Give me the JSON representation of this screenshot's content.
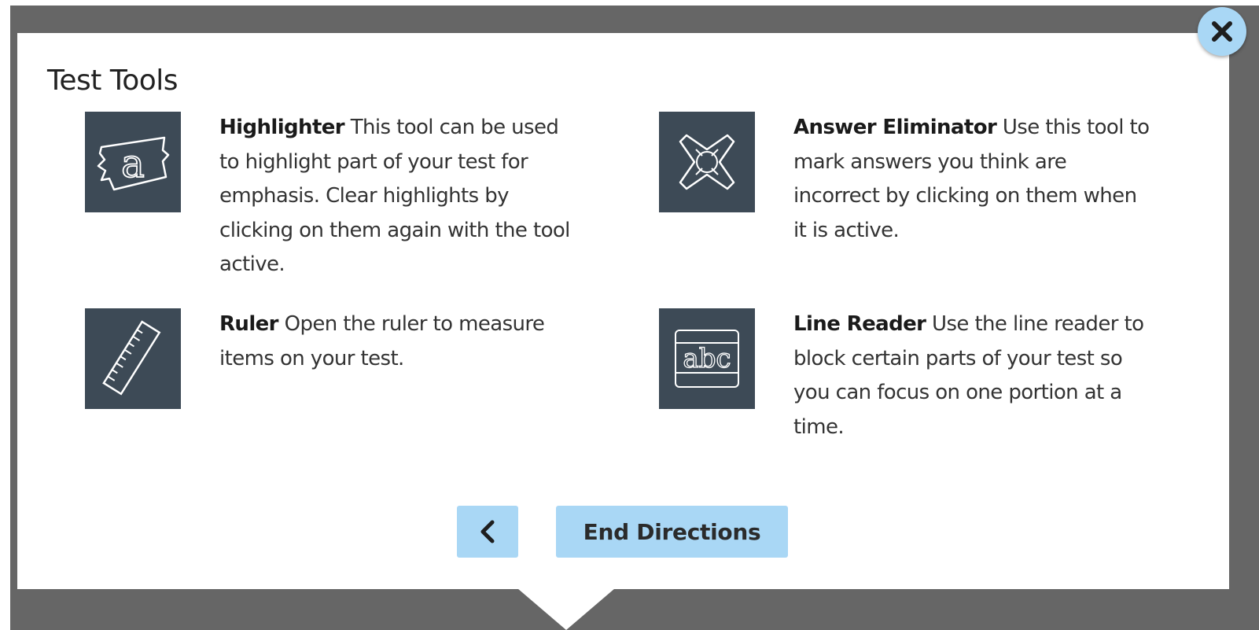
{
  "dialog": {
    "title": "Test Tools"
  },
  "tools": [
    {
      "name": "Highlighter",
      "description": "This tool can be used to highlight part of your test for emphasis. Clear highlights by clicking on them again with the tool active.",
      "icon": "highlighter-icon"
    },
    {
      "name": "Answer Eliminator",
      "description": "Use this tool to mark answers you think are incorrect by clicking on them when it is active.",
      "icon": "answer-eliminator-icon"
    },
    {
      "name": "Ruler",
      "description": "Open the ruler to measure items on your test.",
      "icon": "ruler-icon"
    },
    {
      "name": "Line Reader",
      "description": "Use the line reader to block certain parts of your test so you can focus on one portion at a time.",
      "icon": "line-reader-icon"
    }
  ],
  "buttons": {
    "back_icon": "chevron-left-icon",
    "end_label": "End Directions",
    "close_icon": "close-icon"
  },
  "colors": {
    "overlay": "#666666",
    "icon_tile": "#3d4a56",
    "button_accent": "#a9d7f5"
  }
}
